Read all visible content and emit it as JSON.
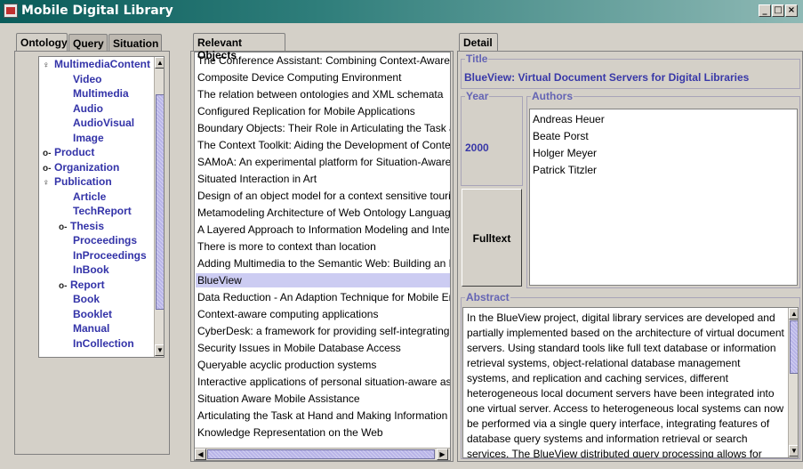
{
  "window": {
    "title": "Mobile Digital Library",
    "minimize": "_",
    "maximize": "□",
    "close": "×"
  },
  "left_tabs": [
    "Ontology",
    "Query",
    "Situation"
  ],
  "ontology_tree": [
    {
      "label": "MultimediaContent",
      "icon": "expanded"
    },
    {
      "label": "Video",
      "icon": ""
    },
    {
      "label": "Multimedia",
      "icon": ""
    },
    {
      "label": "Audio",
      "icon": ""
    },
    {
      "label": "AudioVisual",
      "icon": ""
    },
    {
      "label": "Image",
      "icon": ""
    },
    {
      "label": "Product",
      "icon": "collapsed"
    },
    {
      "label": "Organization",
      "icon": "collapsed"
    },
    {
      "label": "Publication",
      "icon": "expanded"
    },
    {
      "label": "Article",
      "icon": ""
    },
    {
      "label": "TechReport",
      "icon": ""
    },
    {
      "label": "Thesis",
      "icon": "collapsed"
    },
    {
      "label": "Proceedings",
      "icon": ""
    },
    {
      "label": "InProceedings",
      "icon": ""
    },
    {
      "label": "InBook",
      "icon": ""
    },
    {
      "label": "Report",
      "icon": "collapsed"
    },
    {
      "label": "Book",
      "icon": ""
    },
    {
      "label": "Booklet",
      "icon": ""
    },
    {
      "label": "Manual",
      "icon": ""
    },
    {
      "label": "InCollection",
      "icon": ""
    }
  ],
  "middle_tab": "Relevant Objects",
  "relevant_objects": [
    "The Conference Assistant: Combining Context-Aware",
    "Composite Device Computing Environment",
    "The relation between ontologies and XML schemata",
    "Configured Replication for Mobile Applications",
    "Boundary Objects: Their Role in Articulating the Task a",
    "The Context Toolkit: Aiding the Development of Contex",
    "SAMoA: An experimental platform for Situation-Aware I",
    "Situated Interaction in Art",
    "Design of an object model for a context sensitive touri",
    "Metamodeling Architecture of Web Ontology Language",
    "A Layered Approach to Information Modeling and Inter",
    "There is more to context than location",
    "Adding Multimedia to the Semantic Web: Building an M",
    "BlueView",
    "Data Reduction - An Adaption Technique for Mobile En",
    "Context-aware computing applications",
    "CyberDesk: a framework for providing self-integrating",
    "Security Issues in Mobile Database Access",
    "Queryable acyclic production systems",
    "Interactive applications of personal situation-aware as",
    "Situation Aware Mobile Assistance",
    "Articulating the Task at Hand and Making Information",
    "Knowledge Representation on the Web"
  ],
  "selected_object": "BlueView",
  "detail": {
    "tab": "Detail",
    "title_label": "Title",
    "title_value": "BlueView: Virtual Document Servers for Digital Libraries",
    "year_label": "Year",
    "year_value": "2000",
    "authors_label": "Authors",
    "authors": [
      "Andreas Heuer",
      "Beate Porst",
      "Holger Meyer",
      "Patrick Titzler"
    ],
    "fulltext_button": "Fulltext",
    "abstract_label": "Abstract",
    "abstract_lines": [
      "In the BlueView project, digital library services are developed and",
      "partially implemented based on the architecture of virtual document",
      "servers. Using standard tools like full text database or information",
      "retrieval systems, object-relational database management",
      "systems, and replication and caching services, different",
      "heterogeneous local document servers have been integrated into",
      "one virtual server.  Access to heterogeneous local systems can now",
      "be performed via a single query interface, integrating features of",
      "database query systems and information retrieval or search",
      "services. The BlueView distributed query processing allows for"
    ]
  },
  "colors": {
    "tree_text": "#3333a8",
    "selection": "#ccccf2",
    "group_label": "#6464b4",
    "titlebar": "#0a5c5a"
  }
}
